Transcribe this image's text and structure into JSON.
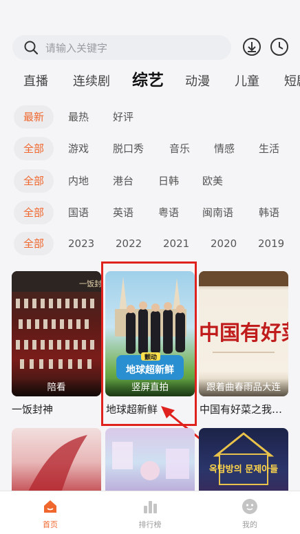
{
  "search": {
    "placeholder": "请输入关键字"
  },
  "header_icons": [
    "download-icon",
    "history-clock-icon"
  ],
  "tabs": [
    {
      "label": "直播"
    },
    {
      "label": "连续剧"
    },
    {
      "label": "综艺",
      "active": true
    },
    {
      "label": "动漫"
    },
    {
      "label": "儿童"
    },
    {
      "label": "短剧"
    }
  ],
  "filters": {
    "sort": [
      "最新",
      "最热",
      "好评"
    ],
    "genre": [
      "全部",
      "游戏",
      "脱口秀",
      "音乐",
      "情感",
      "生活"
    ],
    "region": [
      "全部",
      "内地",
      "港台",
      "日韩",
      "欧美"
    ],
    "language": [
      "全部",
      "国语",
      "英语",
      "粤语",
      "闽南语",
      "韩语"
    ],
    "year": [
      "全部",
      "2023",
      "2022",
      "2021",
      "2020",
      "2019"
    ]
  },
  "cards": [
    {
      "caption": "陪看",
      "title": "一饭封神",
      "poster_text": "一饭封神"
    },
    {
      "caption": "竖屏直拍",
      "title": "地球超新鲜",
      "poster_text": "地球超新鲜",
      "poster_badge": "颤动"
    },
    {
      "caption": "跟着曲春雨品大连",
      "title": "中国有好菜之我…",
      "poster_text": "中国有好菜"
    }
  ],
  "cards_row2": [
    {
      "poster_text": ""
    },
    {
      "poster_text": ""
    },
    {
      "poster_text": "옥탑방의 문제아들"
    }
  ],
  "bottom_nav": [
    {
      "label": "首页",
      "icon": "home-icon",
      "active": true
    },
    {
      "label": "排行榜",
      "icon": "chart-icon"
    },
    {
      "label": "我的",
      "icon": "user-icon"
    }
  ],
  "colors": {
    "accent": "#f0672d",
    "highlight_box": "#e0221f"
  }
}
